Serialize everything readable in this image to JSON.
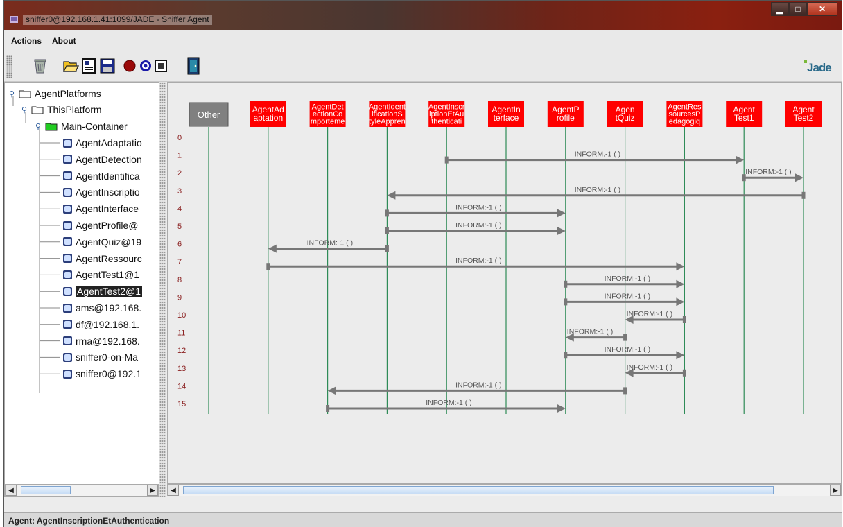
{
  "window": {
    "title": "sniffer0@192.168.1.41:1099/JADE - Sniffer Agent"
  },
  "window_buttons": [
    "minimize",
    "maximize",
    "close"
  ],
  "menu": {
    "actions": "Actions",
    "about": "About"
  },
  "toolbar": {
    "tools": [
      "clear-canvas-icon",
      "open-file-icon",
      "save-script-icon",
      "save-messages-icon",
      "do-sniff-icon",
      "do-not-sniff-icon",
      "show-only-icon",
      "exit-icon"
    ],
    "logo": "Jade"
  },
  "tree": {
    "root": "AgentPlatforms",
    "platform": "ThisPlatform",
    "container": "Main-Container",
    "agents": [
      "AgentAdaptatio",
      "AgentDetection",
      "AgentIdentifica",
      "AgentInscriptio",
      "AgentInterface",
      "AgentProfile@",
      "AgentQuiz@19",
      "AgentRessourc",
      "AgentTest1@1",
      "AgentTest2@1",
      "ams@192.168.",
      "df@192.168.1.",
      "rma@192.168.",
      "sniffer0-on-Ma",
      "sniffer0@192.1"
    ],
    "selected_index": 9
  },
  "sniffer": {
    "other_label": "Other",
    "agents": [
      [
        "AgentAd",
        "aptation"
      ],
      [
        "AgentDet",
        "ectionCo",
        "mporteme"
      ],
      [
        "AgentIdent",
        "ificationS",
        "tyleAppren"
      ],
      [
        "AgentInscr",
        "iptionEtAu",
        "thenticati"
      ],
      [
        "AgentIn",
        "terface"
      ],
      [
        "AgentP",
        "rofile"
      ],
      [
        "Agen",
        "tQuiz"
      ],
      [
        "AgentRes",
        "sourcesP",
        "edagogiq"
      ],
      [
        "Agent",
        "Test1"
      ],
      [
        "Agent",
        "Test2"
      ]
    ],
    "message_label": "INFORM:-1 (     )",
    "row_numbers": [
      "0",
      "1",
      "2",
      "3",
      "4",
      "5",
      "6",
      "7",
      "8",
      "9",
      "10",
      "11",
      "12",
      "13",
      "14",
      "15"
    ],
    "messages": [
      {
        "row": 1,
        "from": 4,
        "to": 9
      },
      {
        "row": 2,
        "from": 9,
        "to": 10
      },
      {
        "row": 3,
        "from": 10,
        "to": 3
      },
      {
        "row": 4,
        "from": 3,
        "to": 6
      },
      {
        "row": 5,
        "from": 3,
        "to": 6
      },
      {
        "row": 6,
        "from": 3,
        "to": 1
      },
      {
        "row": 7,
        "from": 1,
        "to": 8
      },
      {
        "row": 8,
        "from": 6,
        "to": 8
      },
      {
        "row": 9,
        "from": 6,
        "to": 8
      },
      {
        "row": 10,
        "from": 8,
        "to": 7
      },
      {
        "row": 11,
        "from": 7,
        "to": 6
      },
      {
        "row": 12,
        "from": 6,
        "to": 8
      },
      {
        "row": 13,
        "from": 8,
        "to": 7
      },
      {
        "row": 14,
        "from": 7,
        "to": 2
      },
      {
        "row": 15,
        "from": 2,
        "to": 6
      }
    ]
  },
  "status": {
    "text": "Agent: AgentInscriptionEtAuthentication"
  },
  "colors": {
    "agent_box": "#ff0000",
    "other_box": "#808080",
    "lifeline": "#2e8b57",
    "arrow": "#777777",
    "row_number": "#8b2020"
  }
}
